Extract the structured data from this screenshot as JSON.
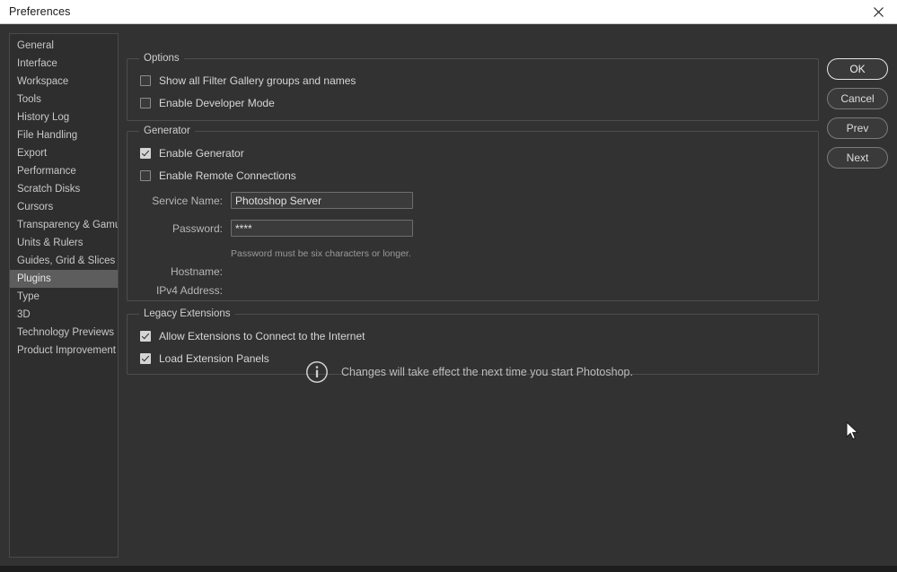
{
  "window": {
    "title": "Preferences",
    "close_icon": "close-icon"
  },
  "sidebar": {
    "items": [
      {
        "label": "General",
        "selected": false
      },
      {
        "label": "Interface",
        "selected": false
      },
      {
        "label": "Workspace",
        "selected": false
      },
      {
        "label": "Tools",
        "selected": false
      },
      {
        "label": "History Log",
        "selected": false
      },
      {
        "label": "File Handling",
        "selected": false
      },
      {
        "label": "Export",
        "selected": false
      },
      {
        "label": "Performance",
        "selected": false
      },
      {
        "label": "Scratch Disks",
        "selected": false
      },
      {
        "label": "Cursors",
        "selected": false
      },
      {
        "label": "Transparency & Gamut",
        "selected": false
      },
      {
        "label": "Units & Rulers",
        "selected": false
      },
      {
        "label": "Guides, Grid & Slices",
        "selected": false
      },
      {
        "label": "Plugins",
        "selected": true
      },
      {
        "label": "Type",
        "selected": false
      },
      {
        "label": "3D",
        "selected": false
      },
      {
        "label": "Technology Previews",
        "selected": false
      },
      {
        "label": "Product Improvement",
        "selected": false
      }
    ]
  },
  "options_group": {
    "legend": "Options",
    "show_filter_gallery": {
      "label": "Show all Filter Gallery groups and names",
      "checked": false
    },
    "enable_developer_mode": {
      "label": "Enable Developer Mode",
      "checked": false
    }
  },
  "generator_group": {
    "legend": "Generator",
    "enable_generator": {
      "label": "Enable Generator",
      "checked": true
    },
    "enable_remote_connections": {
      "label": "Enable Remote Connections",
      "checked": false
    },
    "service_name": {
      "label": "Service Name:",
      "value": "Photoshop Server",
      "placeholder": ""
    },
    "password": {
      "label": "Password:",
      "value": "****",
      "placeholder": ""
    },
    "password_hint": "Password must be six characters or longer.",
    "hostname": {
      "label": "Hostname:",
      "value": ""
    },
    "ipv4_address": {
      "label": "IPv4 Address:",
      "value": ""
    }
  },
  "legacy_group": {
    "legend": "Legacy Extensions",
    "allow_internet": {
      "label": "Allow Extensions to Connect to the Internet",
      "checked": true
    },
    "load_panels": {
      "label": "Load Extension Panels",
      "checked": true
    }
  },
  "info_note": {
    "icon": "info-icon",
    "text": "Changes will take effect the next time you start Photoshop."
  },
  "buttons": {
    "ok": "OK",
    "cancel": "Cancel",
    "prev": "Prev",
    "next": "Next"
  },
  "colors": {
    "dialog_bg": "#323232",
    "titlebar_bg": "#ffffff",
    "sidebar_bg": "#2e2e2e",
    "selection": "#5d5d5d",
    "text": "#d6d6d6",
    "border": "#4d4d4d"
  }
}
